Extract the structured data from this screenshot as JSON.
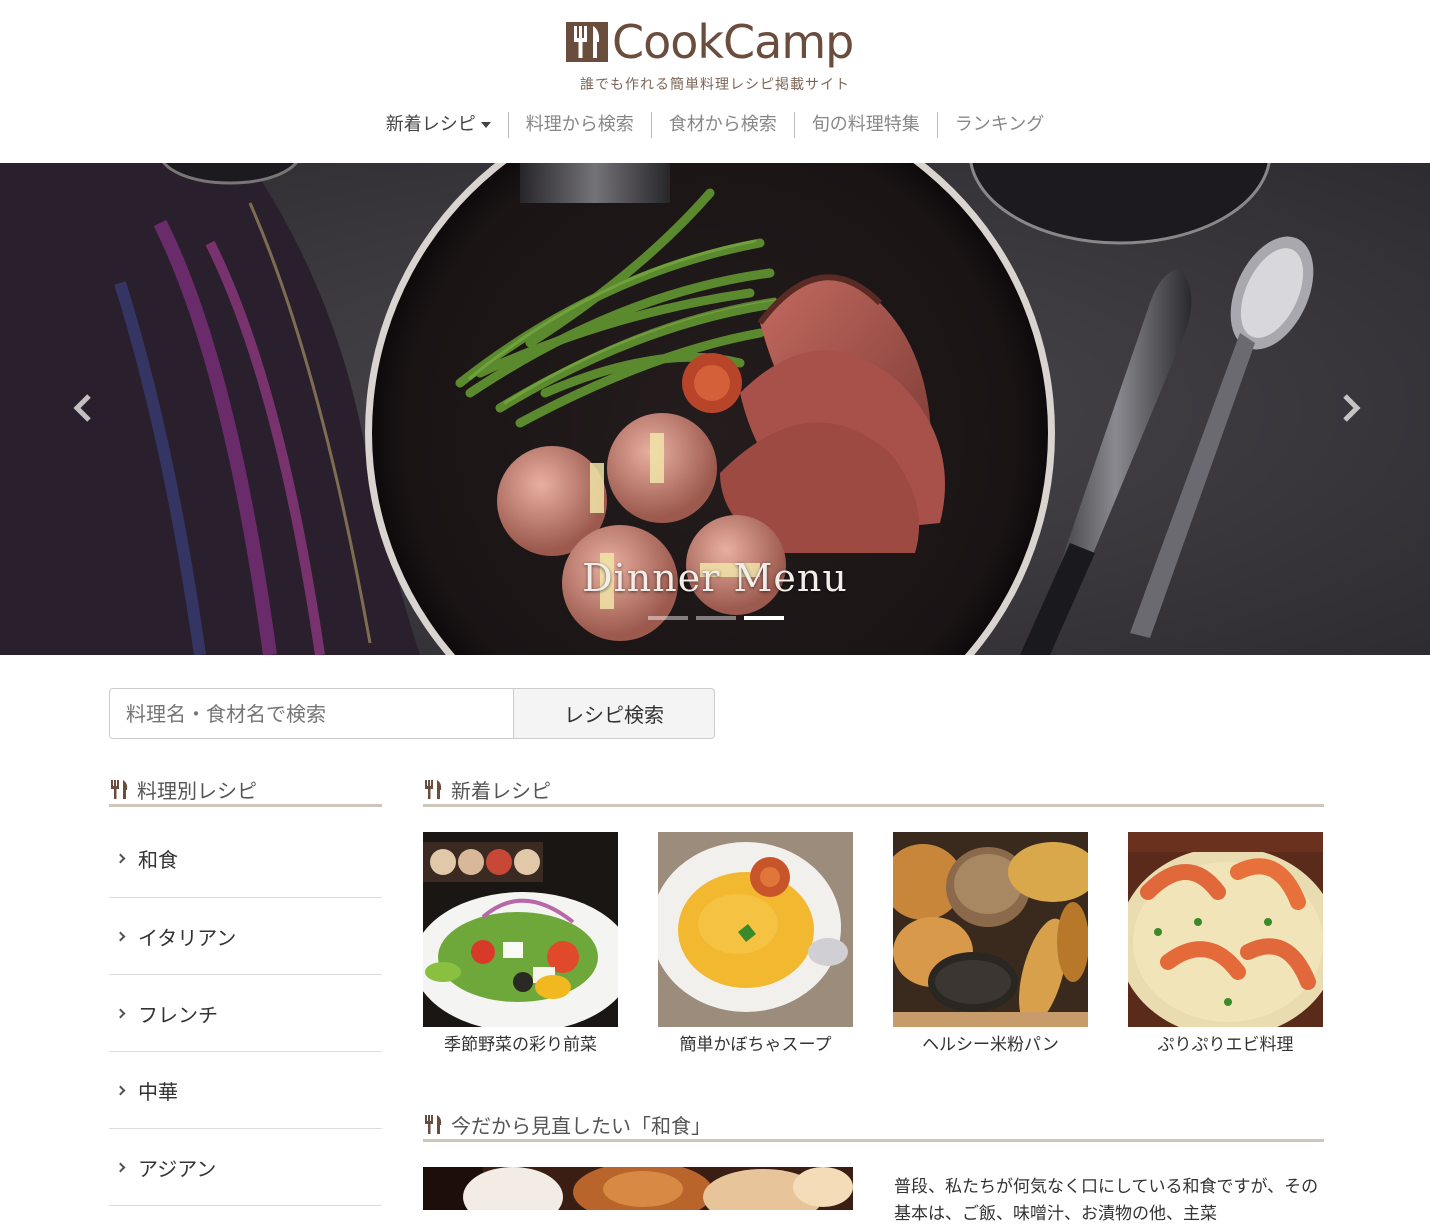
{
  "site": {
    "logo_text": "CookCamp",
    "tagline": "誰でも作れる簡単料理レシピ掲載サイト"
  },
  "nav": {
    "items": [
      "新着レシピ",
      "料理から検索",
      "食材から検索",
      "旬の料理特集",
      "ランキング"
    ]
  },
  "hero": {
    "caption": "Dinner Menu",
    "prev_icon": "chevron-left-icon",
    "next_icon": "chevron-right-icon",
    "slide_count": 3,
    "active_slide": 3
  },
  "search": {
    "placeholder": "料理名・食材名で検索",
    "button_label": "レシピ検索"
  },
  "sidebar": {
    "heading": "料理別レシピ",
    "items": [
      "和食",
      "イタリアン",
      "フレンチ",
      "中華",
      "アジアン"
    ]
  },
  "new_recipes": {
    "heading": "新着レシピ",
    "cards": [
      {
        "title": "季節野菜の彩り前菜"
      },
      {
        "title": "簡単かぼちゃスープ"
      },
      {
        "title": "ヘルシー米粉パン"
      },
      {
        "title": "ぷりぷりエビ料理"
      }
    ]
  },
  "washoku": {
    "heading": "今だから見直したい「和食」",
    "text": "普段、私たちが何気なく口にしている和食ですが、その基本は、ご飯、味噌汁、お漬物の他、主菜"
  },
  "colors": {
    "brand": "#6b4d3e",
    "heading_rule": "#cfc6bb"
  }
}
